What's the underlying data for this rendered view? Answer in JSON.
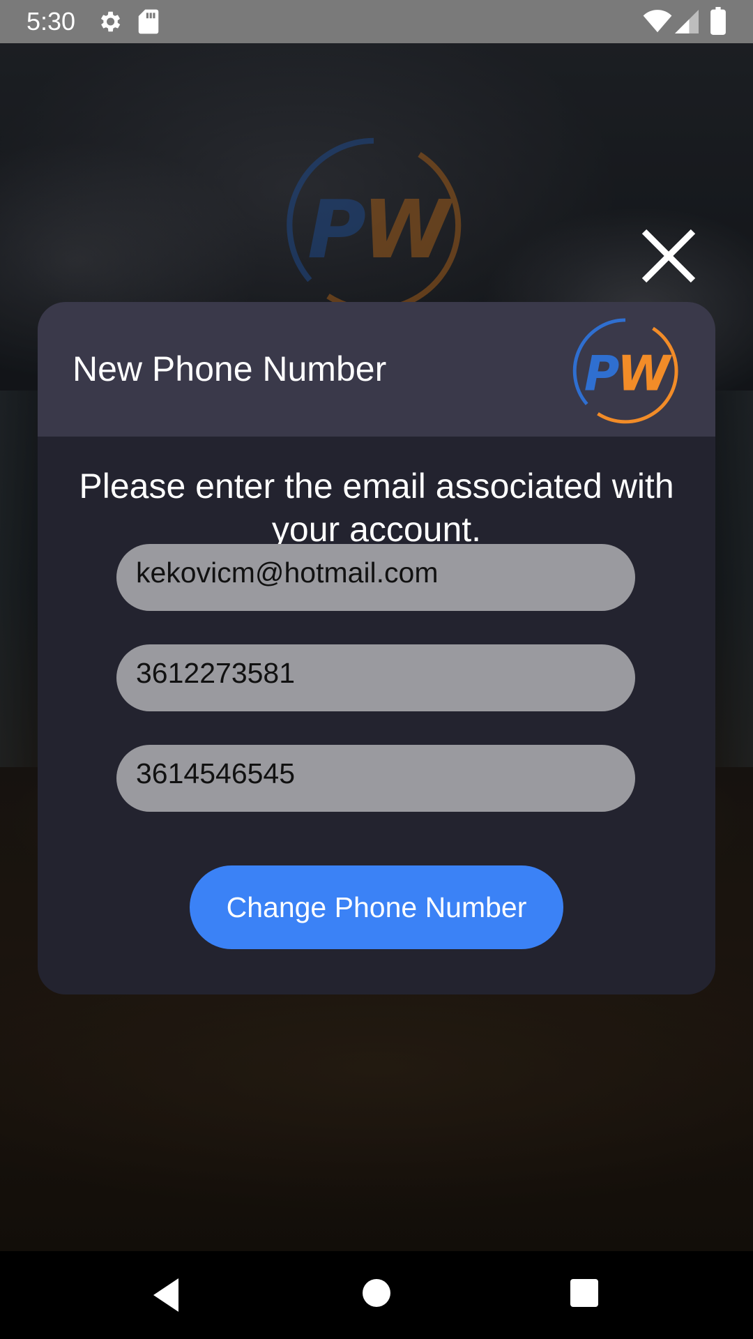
{
  "status_bar": {
    "time": "5:30",
    "icons": [
      "gear-icon",
      "sd-card-icon",
      "wifi-icon",
      "signal-icon",
      "battery-icon"
    ]
  },
  "background": {
    "logo_text": "PW"
  },
  "dialog": {
    "title": "New Phone Number",
    "logo_text": "PW",
    "message": "Please enter the email associated with your account.",
    "email_field": {
      "value": "kekovicm@hotmail.com"
    },
    "current_phone_field": {
      "value": "3612273581"
    },
    "new_phone_field": {
      "value": "3614546545"
    },
    "submit_label": "Change Phone Number"
  },
  "close_button": {
    "icon": "close-icon"
  },
  "nav_bar": {
    "buttons": [
      "back-icon",
      "home-icon",
      "recents-icon"
    ]
  },
  "colors": {
    "status_bar": "#7a7a7a",
    "dialog_header": "#3a394a",
    "dialog_body": "#23232f",
    "field_bg": "#9a9a9f",
    "primary_button": "#3b82f6",
    "logo_blue": "#2f6fd0",
    "logo_orange": "#f28c28"
  }
}
